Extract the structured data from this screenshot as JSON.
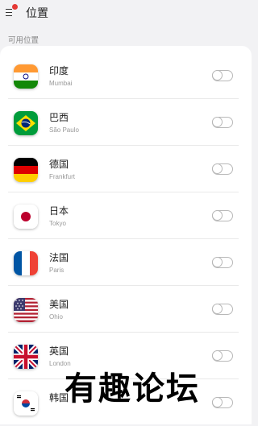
{
  "header": {
    "title": "位置"
  },
  "section_label": "可用位置",
  "locations": [
    {
      "name": "印度",
      "city": "Mumbai",
      "flag_icon": "india-flag-icon",
      "enabled": false
    },
    {
      "name": "巴西",
      "city": "São Paulo",
      "flag_icon": "brazil-flag-icon",
      "enabled": false
    },
    {
      "name": "德国",
      "city": "Frankfurt",
      "flag_icon": "germany-flag-icon",
      "enabled": false
    },
    {
      "name": "日本",
      "city": "Tokyo",
      "flag_icon": "japan-flag-icon",
      "enabled": false
    },
    {
      "name": "法国",
      "city": "Paris",
      "flag_icon": "france-flag-icon",
      "enabled": false
    },
    {
      "name": "美国",
      "city": "Ohio",
      "flag_icon": "usa-flag-icon",
      "enabled": false
    },
    {
      "name": "英国",
      "city": "London",
      "flag_icon": "uk-flag-icon",
      "enabled": false
    },
    {
      "name": "韩国",
      "city": "",
      "flag_icon": "south-korea-flag-icon",
      "enabled": false
    }
  ],
  "watermark": "有趣论坛",
  "colors": {
    "notification_dot": "#e53935",
    "background": "#f2f2f4",
    "card": "#ffffff"
  }
}
